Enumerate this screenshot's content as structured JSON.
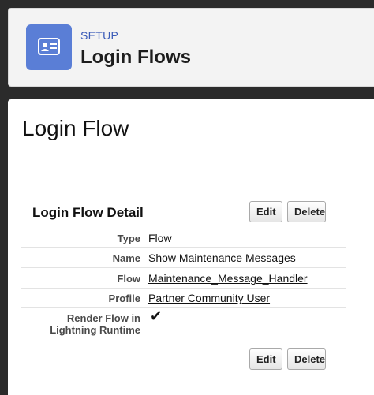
{
  "header": {
    "icon": "contact-card-icon",
    "eyebrow": "SETUP",
    "title": "Login Flows"
  },
  "page": {
    "title": "Login Flow"
  },
  "detail": {
    "section_title": "Login Flow Detail",
    "edit_label": "Edit",
    "delete_label": "Delete",
    "rows": [
      {
        "label": "Type",
        "value": "Flow"
      },
      {
        "label": "Name",
        "value": "Show Maintenance Messages"
      },
      {
        "label": "Flow",
        "value": "Maintenance_Message_Handler"
      },
      {
        "label": "Profile",
        "value": "Partner Community User"
      },
      {
        "label_line1": "Render Flow in",
        "label_line2": "Lightning Runtime",
        "value": "✔"
      }
    ]
  },
  "colors": {
    "accent": "#5a7ed6",
    "eyebrow": "#3a5bb8"
  }
}
